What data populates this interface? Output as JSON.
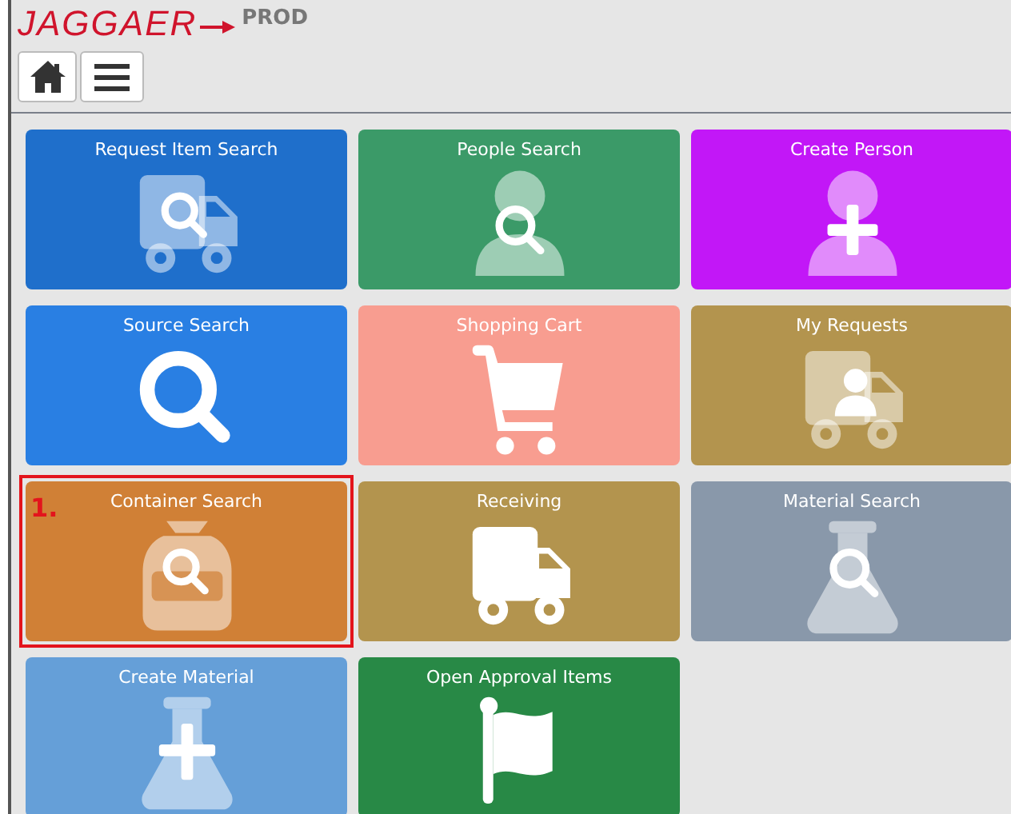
{
  "header": {
    "logo": "JAGGAER",
    "environment": "PROD"
  },
  "tiles": [
    {
      "label": "Request Item Search",
      "color": "#1f6fcb"
    },
    {
      "label": "People Search",
      "color": "#3b9a68"
    },
    {
      "label": "Create Person",
      "color": "#c217f7"
    },
    {
      "label": "Source Search",
      "color": "#297fe3"
    },
    {
      "label": "Shopping Cart",
      "color": "#f89d90"
    },
    {
      "label": "My Requests",
      "color": "#b3944e"
    },
    {
      "label": "Container Search",
      "color": "#d08036",
      "callout": "1."
    },
    {
      "label": "Receiving",
      "color": "#b3944e"
    },
    {
      "label": "Material Search",
      "color": "#8998aa"
    },
    {
      "label": "Create Material",
      "color": "#659fd8"
    },
    {
      "label": "Open Approval Items",
      "color": "#288946"
    }
  ]
}
